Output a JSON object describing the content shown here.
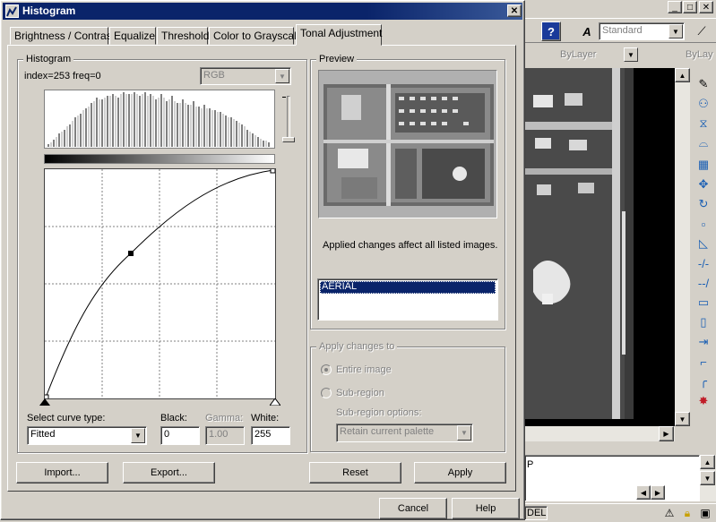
{
  "dialog": {
    "title": "Histogram",
    "close_label": "✕",
    "tabs": [
      "Brightness / Contrast",
      "Equalize",
      "Threshold",
      "Color to Grayscale",
      "Tonal Adjustment"
    ],
    "active_tab": "Tonal Adjustment"
  },
  "histogram": {
    "group_label": "Histogram",
    "info": "index=253 freq=0",
    "channel": "RGB"
  },
  "curve": {
    "type_label": "Select curve type:",
    "type_value": "Fitted",
    "black_label": "Black:",
    "black_value": "0",
    "gamma_label": "Gamma:",
    "gamma_value": "1.00",
    "white_label": "White:",
    "white_value": "255"
  },
  "preview": {
    "group_label": "Preview",
    "note": "Applied changes affect all listed images.",
    "images": [
      "AERIAL"
    ]
  },
  "apply_to": {
    "group_label": "Apply changes to",
    "entire_label": "Entire image",
    "sub_label": "Sub-region",
    "options_label": "Sub-region options:",
    "options_value": "Retain current palette"
  },
  "buttons": {
    "import": "Import...",
    "export": "Export...",
    "reset": "Reset",
    "apply": "Apply",
    "cancel": "Cancel",
    "help": "Help"
  },
  "cad": {
    "text_style": "Standard",
    "layer1": "ByLayer",
    "layer2": "ByLay",
    "command_text": "P",
    "model_tab": "DEL",
    "win_min": "_",
    "win_max": "□",
    "win_close": "✕"
  },
  "colors": {
    "title_bar": "#0a246a",
    "face": "#d4d0c8",
    "selection": "#0a246a"
  }
}
